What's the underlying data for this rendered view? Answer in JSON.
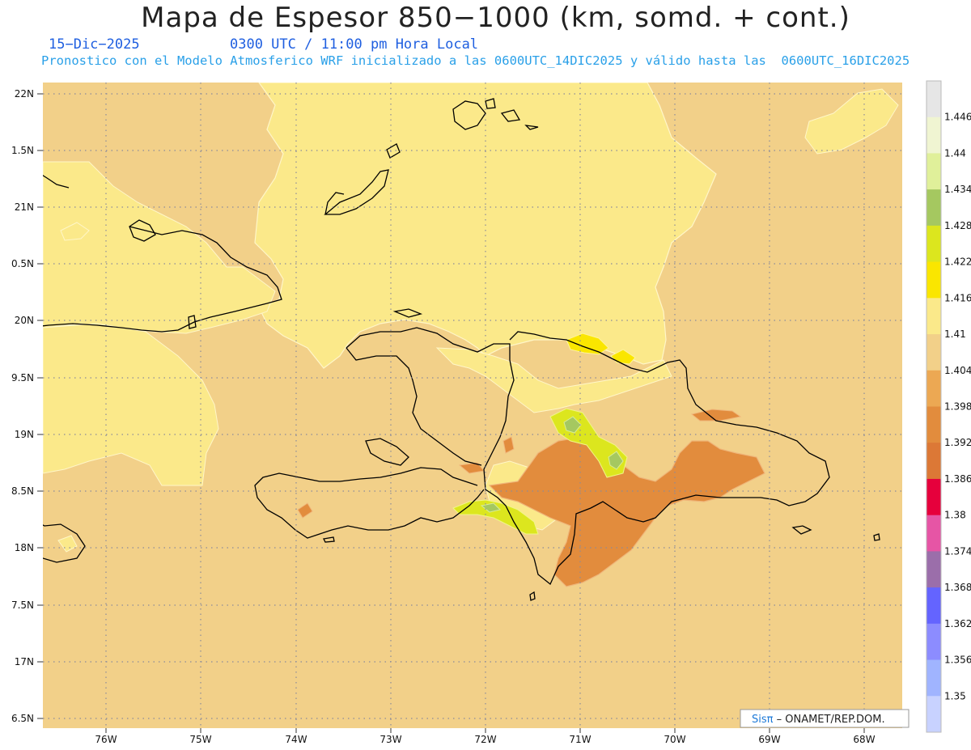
{
  "title": "Mapa de Espesor 850−1000 (km, somd. + cont.)",
  "date": "15−Dic−2025",
  "time": "0300 UTC / 11:00 pm Hora Local",
  "forecast_info": "Pronostico con el Modelo Atmosferico WRF inicializado a las 0600UTC_14DIC2025 y válido hasta las  0600UTC_16DIC2025",
  "credit": {
    "brand": "Sisπ",
    "text": " ONAMET/REP.DOM."
  },
  "lat_labels": [
    "22N",
    "1.5N",
    "21N",
    "0.5N",
    "20N",
    "9.5N",
    "19N",
    "8.5N",
    "18N",
    "7.5N",
    "17N",
    "6.5N"
  ],
  "lon_labels": [
    "76W",
    "75W",
    "74W",
    "73W",
    "72W",
    "71W",
    "70W",
    "69W",
    "68W"
  ],
  "colorbar": {
    "labels": [
      "1.446",
      "1.44",
      "1.434",
      "1.428",
      "1.422",
      "1.416",
      "1.41",
      "1.404",
      "1.398",
      "1.392",
      "1.386",
      "1.38",
      "1.374",
      "1.368",
      "1.362",
      "1.356",
      "1.35"
    ],
    "colors": [
      "#e6e6e6",
      "#f0f5d2",
      "#e0f09a",
      "#a5c860",
      "#dce61e",
      "#fae600",
      "#fbe98a",
      "#f2d089",
      "#eca853",
      "#e28c3d",
      "#dc7836",
      "#e6003c",
      "#e655a5",
      "#9b6eaa",
      "#6464ff",
      "#8c8cff",
      "#a0b4ff",
      "#c8d2ff"
    ]
  },
  "colors": {
    "base": "#f2d089",
    "light_yellow": "#fbe98a",
    "orange": "#e28c3d",
    "yellow": "#fae600",
    "lime": "#dce61e",
    "green": "#a5c860",
    "coast": "#000000",
    "grid": "#8a8a9a"
  }
}
